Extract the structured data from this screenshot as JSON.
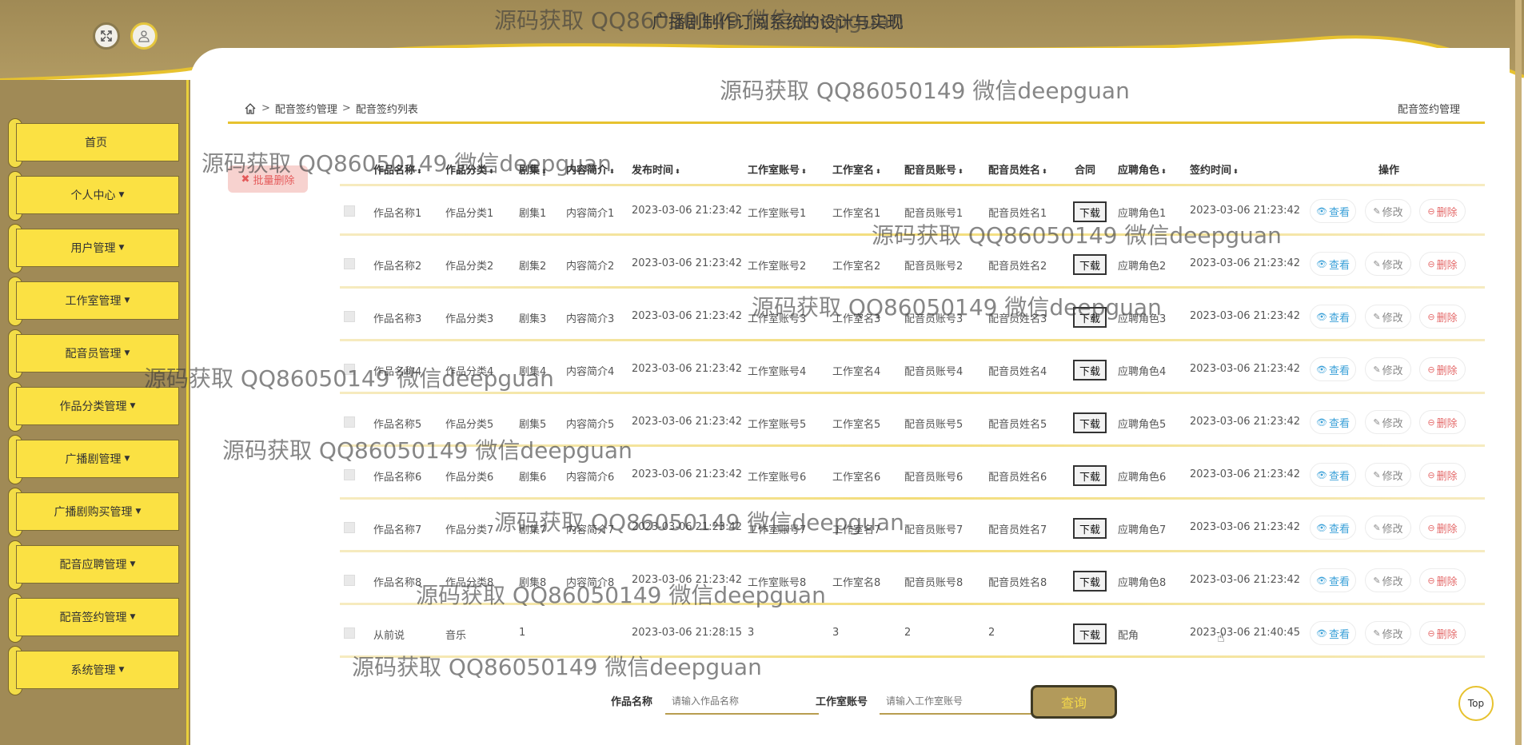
{
  "app": {
    "title": "广播剧制作订阅系统的设计与实现"
  },
  "sidebar": {
    "items": [
      {
        "label": "首页",
        "caret": ""
      },
      {
        "label": "个人中心",
        "caret": "▼"
      },
      {
        "label": "用户管理",
        "caret": "▼"
      },
      {
        "label": "工作室管理",
        "caret": "▼"
      },
      {
        "label": "配音员管理",
        "caret": "▼"
      },
      {
        "label": "作品分类管理",
        "caret": "▼"
      },
      {
        "label": "广播剧管理",
        "caret": "▼"
      },
      {
        "label": "广播剧购买管理",
        "caret": "▼"
      },
      {
        "label": "配音应聘管理",
        "caret": "▼"
      },
      {
        "label": "配音签约管理",
        "caret": "▼"
      },
      {
        "label": "系统管理",
        "caret": "▼"
      }
    ]
  },
  "breadcrumb": {
    "items": [
      "配音签约管理",
      "配音签约列表"
    ],
    "sep": ">",
    "right": "配音签约管理"
  },
  "toolbar": {
    "batch_delete": "批量删除"
  },
  "table": {
    "headers": [
      "作品名称",
      "作品分类",
      "剧集",
      "内容简介",
      "发布时间",
      "工作室账号",
      "工作室名",
      "配音员账号",
      "配音员姓名",
      "合同",
      "应聘角色",
      "签约时间",
      "操作"
    ],
    "sort_icon": "⬍",
    "rows": [
      [
        "作品名称1",
        "作品分类1",
        "剧集1",
        "内容简介1",
        "2023-03-06 21:23:42",
        "工作室账号1",
        "工作室名1",
        "配音员账号1",
        "配音员姓名1",
        "下载",
        "应聘角色1",
        "2023-03-06 21:23:42"
      ],
      [
        "作品名称2",
        "作品分类2",
        "剧集2",
        "内容简介2",
        "2023-03-06 21:23:42",
        "工作室账号2",
        "工作室名2",
        "配音员账号2",
        "配音员姓名2",
        "下载",
        "应聘角色2",
        "2023-03-06 21:23:42"
      ],
      [
        "作品名称3",
        "作品分类3",
        "剧集3",
        "内容简介3",
        "2023-03-06 21:23:42",
        "工作室账号3",
        "工作室名3",
        "配音员账号3",
        "配音员姓名3",
        "下载",
        "应聘角色3",
        "2023-03-06 21:23:42"
      ],
      [
        "作品名称4",
        "作品分类4",
        "剧集4",
        "内容简介4",
        "2023-03-06 21:23:42",
        "工作室账号4",
        "工作室名4",
        "配音员账号4",
        "配音员姓名4",
        "下载",
        "应聘角色4",
        "2023-03-06 21:23:42"
      ],
      [
        "作品名称5",
        "作品分类5",
        "剧集5",
        "内容简介5",
        "2023-03-06 21:23:42",
        "工作室账号5",
        "工作室名5",
        "配音员账号5",
        "配音员姓名5",
        "下载",
        "应聘角色5",
        "2023-03-06 21:23:42"
      ],
      [
        "作品名称6",
        "作品分类6",
        "剧集6",
        "内容简介6",
        "2023-03-06 21:23:42",
        "工作室账号6",
        "工作室名6",
        "配音员账号6",
        "配音员姓名6",
        "下载",
        "应聘角色6",
        "2023-03-06 21:23:42"
      ],
      [
        "作品名称7",
        "作品分类7",
        "剧集7",
        "内容简介7",
        "2023-03-06 21:23:42",
        "工作室账号7",
        "工作室名7",
        "配音员账号7",
        "配音员姓名7",
        "下载",
        "应聘角色7",
        "2023-03-06 21:23:42"
      ],
      [
        "作品名称8",
        "作品分类8",
        "剧集8",
        "内容简介8",
        "2023-03-06 21:23:42",
        "工作室账号8",
        "工作室名8",
        "配音员账号8",
        "配音员姓名8",
        "下载",
        "应聘角色8",
        "2023-03-06 21:23:42"
      ],
      [
        "从前说",
        "音乐",
        "1",
        "",
        "2023-03-06 21:28:15",
        "3",
        "3",
        "2",
        "2",
        "下载",
        "配角",
        "2023-03-06 21:40:45"
      ]
    ],
    "actions": {
      "view": "查看",
      "edit": "修改",
      "del": "删除"
    }
  },
  "search": {
    "name_label": "作品名称",
    "name_placeholder": "请输入作品名称",
    "studio_label": "工作室账号",
    "studio_placeholder": "请输入工作室账号",
    "button": "查询"
  },
  "top_button": "Top",
  "watermark": "源码获取 QQ86050149 微信deepguan",
  "colors": {
    "accent": "#fbe143",
    "sidebar": "#a08a56",
    "gold_line": "#e7c22f",
    "view": "#3aa0d8",
    "delete": "#e46a6a"
  }
}
